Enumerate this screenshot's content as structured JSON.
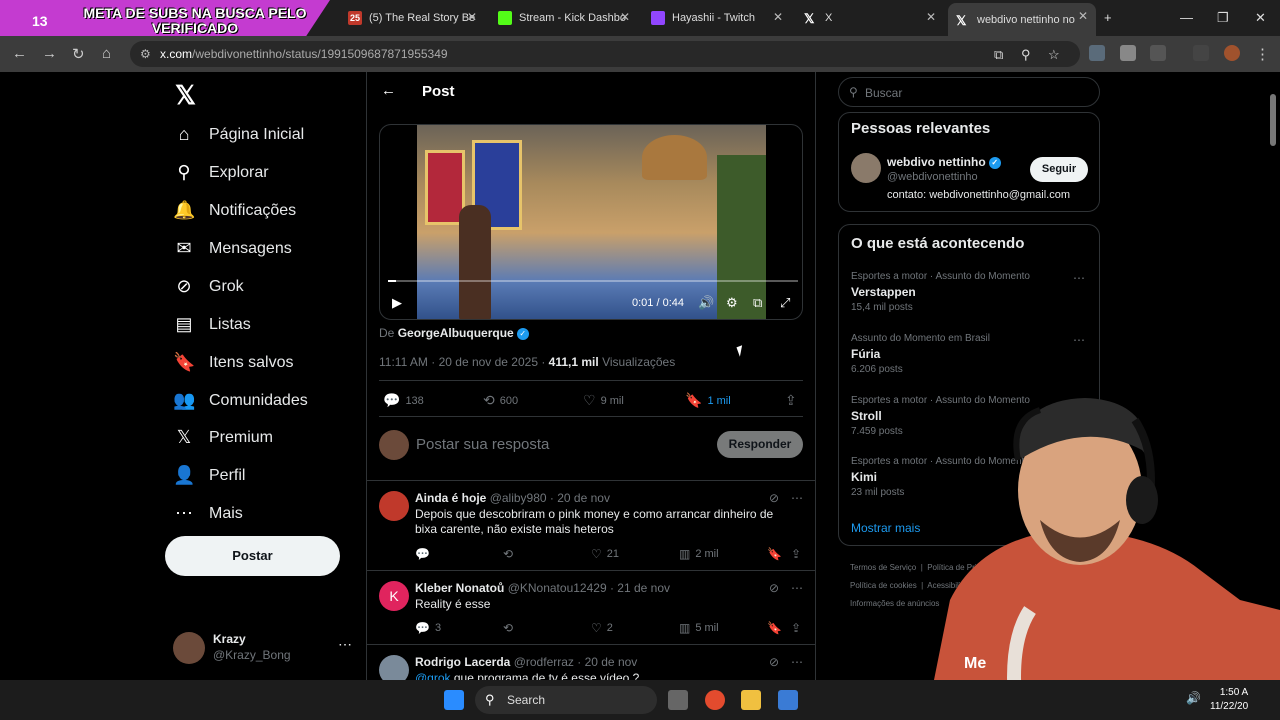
{
  "overlay": {
    "count": "13",
    "text": "META DE SUBS NA BUSCA PELO VERIFICADO"
  },
  "tabs": [
    {
      "label": "(5) The Real Story Be",
      "badge": "25",
      "favicon_color": "#c0392b"
    },
    {
      "label": "Stream - Kick Dashbo",
      "favicon_color": "#53fc18"
    },
    {
      "label": "Hayashii - Twitch",
      "favicon_color": "#9146ff"
    },
    {
      "label": "X",
      "favicon_color": "#ffffff"
    },
    {
      "label": "webdivo nettinho no",
      "favicon_color": "#ffffff"
    }
  ],
  "address": {
    "host": "x.com",
    "path": "/webdivonettinho/status/1991509687871955349"
  },
  "nav": {
    "items": [
      {
        "label": "Página Inicial",
        "icon": "home-icon",
        "glyph": "⌂"
      },
      {
        "label": "Explorar",
        "icon": "search-icon",
        "glyph": "⚲"
      },
      {
        "label": "Notificações",
        "icon": "bell-icon",
        "glyph": "🔔"
      },
      {
        "label": "Mensagens",
        "icon": "mail-icon",
        "glyph": "✉"
      },
      {
        "label": "Grok",
        "icon": "grok-icon",
        "glyph": "⊘"
      },
      {
        "label": "Listas",
        "icon": "list-icon",
        "glyph": "▤"
      },
      {
        "label": "Itens salvos",
        "icon": "bookmark-icon",
        "glyph": "🔖"
      },
      {
        "label": "Comunidades",
        "icon": "communities-icon",
        "glyph": "👥"
      },
      {
        "label": "Premium",
        "icon": "x-logo-icon",
        "glyph": "𝕏"
      },
      {
        "label": "Perfil",
        "icon": "profile-icon",
        "glyph": "👤"
      },
      {
        "label": "Mais",
        "icon": "more-circle-icon",
        "glyph": "⋯"
      }
    ],
    "post_button": "Postar",
    "account": {
      "name": "Krazy",
      "handle": "@Krazy_Bong"
    }
  },
  "post": {
    "header": "Post",
    "video": {
      "time": "0:01 / 0:44",
      "progress": 0.02
    },
    "by_prefix": "De",
    "by_user": "GeorgeAlbuquerque",
    "meta": {
      "time": "11:11 AM · 20 de nov de 2025 · ",
      "views": "411,1 mil",
      "views_label": "Visualizações"
    },
    "actions": {
      "replies": "138",
      "reposts": "600",
      "likes": "9 mil",
      "bookmarks": "1 mil"
    },
    "reply_placeholder": "Postar sua resposta",
    "reply_button": "Responder"
  },
  "replies": [
    {
      "name": "Ainda é hoje",
      "handle": "@aliby980",
      "date": "20 de nov",
      "text": "Depois que descobriram o pink money e como arrancar dinheiro de bixa carente, não existe mais heteros",
      "comments": "",
      "reposts": "",
      "likes": "21",
      "views": "2 mil",
      "avatar_color": "#c0392b"
    },
    {
      "name": "Kleber Nonatoů",
      "handle": "@KNonatou12429",
      "date": "21 de nov",
      "text": "Reality é esse",
      "avatar_letter": "K",
      "comments": "3",
      "reposts": "",
      "likes": "2",
      "views": "5 mil",
      "avatar_color": "#e0245e"
    },
    {
      "name": "Rodrigo Lacerda",
      "handle": "@rodferraz",
      "date": "20 de nov",
      "mention": "@grok",
      "text": " que programa de tv é esse vídeo ?",
      "avatar_color": "#7a8a9a"
    }
  ],
  "right": {
    "search_placeholder": "Buscar",
    "relevant": {
      "title": "Pessoas relevantes",
      "name": "webdivo nettinho",
      "handle": "@webdivonettinho",
      "bio": "contato: webdivonettinho@gmail.com",
      "follow": "Seguir"
    },
    "trending": {
      "title": "O que está acontecendo",
      "items": [
        {
          "category": "Esportes a motor · Assunto do Momento",
          "name": "Verstappen",
          "count": "15,4 mil posts"
        },
        {
          "category": "Assunto do Momento em Brasil",
          "name": "Fúria",
          "count": "6.206 posts"
        },
        {
          "category": "Esportes a motor · Assunto do Momento",
          "name": "Stroll",
          "count": "7.459 posts"
        },
        {
          "category": "Esportes a motor · Assunto do Momento",
          "name": "Kimi",
          "count": "23 mil posts"
        }
      ],
      "show_more": "Mostrar mais"
    },
    "footer": [
      "Termos de Serviço",
      "Política de Privacidade",
      "Política de cookies",
      "Acessibilidade",
      "Informações de anúncios"
    ]
  },
  "taskbar": {
    "search": "Search",
    "time": "1:50 A",
    "date": "11/22/20"
  }
}
